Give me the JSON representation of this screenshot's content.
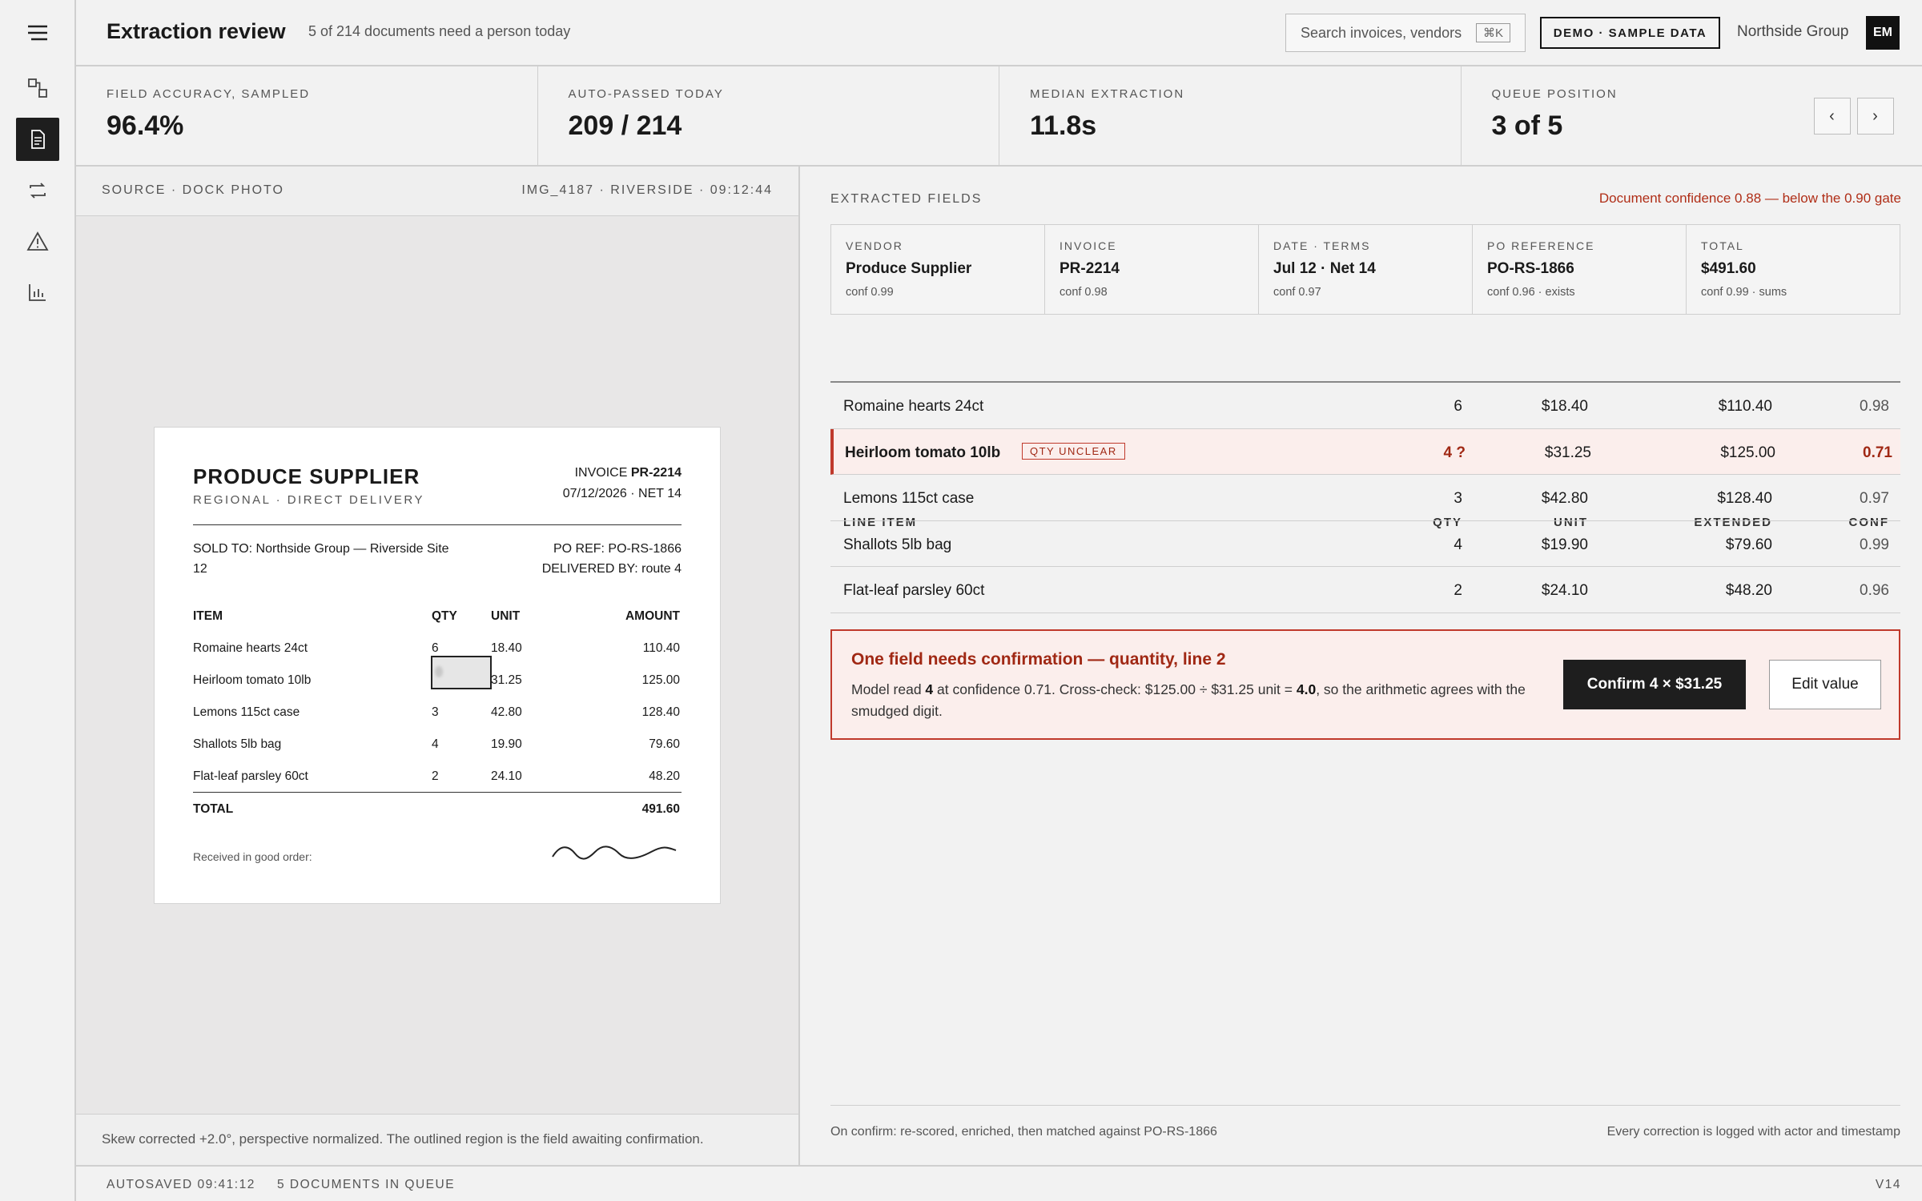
{
  "header": {
    "title": "Extraction review",
    "subtitle": "5 of 214 documents need a person today",
    "search_placeholder": "Search invoices, vendors",
    "search_shortcut": "⌘K",
    "demo_badge": "DEMO · SAMPLE DATA",
    "org": "Northside Group",
    "avatar_initials": "EM"
  },
  "sidebar": {
    "items": [
      {
        "icon": "workflow-icon"
      },
      {
        "icon": "document-icon",
        "active": true
      },
      {
        "icon": "repeat-icon"
      },
      {
        "icon": "warning-icon"
      },
      {
        "icon": "bar-chart-icon"
      }
    ]
  },
  "kpis": [
    {
      "label": "FIELD ACCURACY, SAMPLED",
      "value": "96.4%"
    },
    {
      "label": "AUTO-PASSED TODAY",
      "value": "209 / 214"
    },
    {
      "label": "MEDIAN EXTRACTION",
      "value": "11.8s"
    },
    {
      "label": "QUEUE POSITION",
      "value": "3 of 5"
    }
  ],
  "queue_nav": {
    "prev": "‹",
    "next": "›"
  },
  "source": {
    "label": "SOURCE · DOCK PHOTO",
    "meta": "IMG_4187 · RIVERSIDE · 09:12:44",
    "footer": "Skew corrected +2.0°, perspective normalized. The outlined region is the field awaiting confirmation."
  },
  "invoice_doc": {
    "vendor": "PRODUCE SUPPLIER",
    "tagline": "REGIONAL · DIRECT DELIVERY",
    "invoice_prefix": "INVOICE",
    "invoice_no": "PR-2214",
    "date_terms": "07/12/2026 · NET 14",
    "sold_to": "SOLD TO: Northside Group — Riverside Site 12",
    "po_ref": "PO REF: PO-RS-1866",
    "delivered_by": "DELIVERED BY: route 4",
    "headers": {
      "item": "ITEM",
      "qty": "QTY",
      "unit": "UNIT",
      "amount": "AMOUNT"
    },
    "rows": [
      {
        "item": "Romaine hearts 24ct",
        "qty": "6",
        "unit": "18.40",
        "amount": "110.40"
      },
      {
        "item": "Heirloom tomato 10lb",
        "qty": "",
        "unit": "31.25",
        "amount": "125.00"
      },
      {
        "item": "Lemons 115ct case",
        "qty": "3",
        "unit": "42.80",
        "amount": "128.40"
      },
      {
        "item": "Shallots 5lb bag",
        "qty": "4",
        "unit": "19.90",
        "amount": "79.60"
      },
      {
        "item": "Flat-leaf parsley 60ct",
        "qty": "2",
        "unit": "24.10",
        "amount": "48.20"
      }
    ],
    "total_label": "TOTAL",
    "total": "491.60",
    "received": "Received in good order:"
  },
  "extracted": {
    "label": "EXTRACTED FIELDS",
    "warning": "Document confidence 0.88 — below the 0.90 gate",
    "fields": [
      {
        "label": "VENDOR",
        "value": "Produce Supplier",
        "conf": "conf 0.99"
      },
      {
        "label": "INVOICE",
        "value": "PR-2214",
        "conf": "conf 0.98"
      },
      {
        "label": "DATE · TERMS",
        "value": "Jul 12 · Net 14",
        "conf": "conf 0.97"
      },
      {
        "label": "PO REFERENCE",
        "value": "PO-RS-1866",
        "conf": "conf 0.96 · exists"
      },
      {
        "label": "TOTAL",
        "value": "$491.60",
        "conf": "conf 0.99 · sums"
      }
    ]
  },
  "line_items": {
    "headers": {
      "item": "LINE ITEM",
      "qty": "QTY",
      "unit": "UNIT",
      "extended": "EXTENDED",
      "conf": "CONF"
    },
    "rows": [
      {
        "item": "Romaine hearts 24ct",
        "qty": "6",
        "unit": "$18.40",
        "extended": "$110.40",
        "conf": "0.98"
      },
      {
        "item": "Heirloom tomato 10lb",
        "qty": "4 ?",
        "unit": "$31.25",
        "extended": "$125.00",
        "conf": "0.71",
        "badge": "QTY UNCLEAR"
      },
      {
        "item": "Lemons 115ct case",
        "qty": "3",
        "unit": "$42.80",
        "extended": "$128.40",
        "conf": "0.97"
      },
      {
        "item": "Shallots 5lb bag",
        "qty": "4",
        "unit": "$19.90",
        "extended": "$79.60",
        "conf": "0.99"
      },
      {
        "item": "Flat-leaf parsley 60ct",
        "qty": "2",
        "unit": "$24.10",
        "extended": "$48.20",
        "conf": "0.96"
      }
    ]
  },
  "confirmation": {
    "title": "One field needs confirmation — quantity, line 2",
    "body_1": "Model read ",
    "body_val": "4",
    "body_2": " at confidence 0.71. Cross-check: $125.00 ÷ $31.25 unit = ",
    "body_calc": "4.0",
    "body_3": ", so the arithmetic agrees with the smudged digit.",
    "confirm_label": "Confirm 4 × $31.25",
    "edit_label": "Edit value"
  },
  "right_footer": {
    "left": "On confirm: re-scored, enriched, then matched against PO-RS-1866",
    "right": "Every correction is logged with actor and timestamp"
  },
  "statusbar": {
    "autosave": "AUTOSAVED 09:41:12",
    "queue": "5 DOCUMENTS IN QUEUE",
    "version": "V14"
  }
}
